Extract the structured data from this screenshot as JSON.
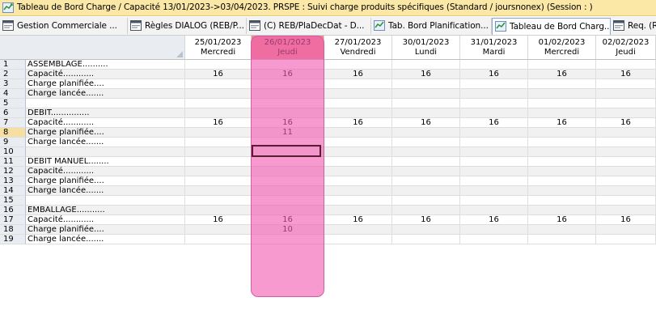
{
  "window": {
    "title": "Tableau de Bord Charge / Capacité 13/01/2023->03/04/2023. PRSPE : Suivi charge produits spécifiques (Standard / joursnonex) (Session : )",
    "icon": "tableau-board-icon"
  },
  "tabs": [
    {
      "label": "Gestion Commerciale ...",
      "icon": "window-icon",
      "active": false
    },
    {
      "label": "Règles DIALOG (REB/P...",
      "icon": "window-icon",
      "active": false
    },
    {
      "label": "(C) REB/PlaDecDat - D...",
      "icon": "window-icon",
      "active": false
    },
    {
      "label": "Tab. Bord Planification...",
      "icon": "tableau-board-icon",
      "active": false
    },
    {
      "label": "Tableau de Bord Charg...",
      "icon": "tableau-board-icon",
      "active": true
    },
    {
      "label": "Req. (R",
      "icon": "window-icon",
      "active": false
    }
  ],
  "columns": [
    {
      "date": "25/01/2023",
      "day": "Mercredi"
    },
    {
      "date": "26/01/2023",
      "day": "Jeudi",
      "highlighted": true
    },
    {
      "date": "27/01/2023",
      "day": "Vendredi"
    },
    {
      "date": "30/01/2023",
      "day": "Lundi"
    },
    {
      "date": "31/01/2023",
      "day": "Mardi"
    },
    {
      "date": "01/02/2023",
      "day": "Mercredi"
    },
    {
      "date": "02/02/2023",
      "day": "Jeudi"
    }
  ],
  "rows": [
    {
      "n": "1",
      "label": "ASSEMBLAGE..........",
      "values": [
        "",
        "",
        "",
        "",
        "",
        "",
        ""
      ]
    },
    {
      "n": "2",
      "label": "Capacité............",
      "values": [
        "16",
        "16",
        "16",
        "16",
        "16",
        "16",
        "16"
      ]
    },
    {
      "n": "3",
      "label": "Charge planifiée....",
      "values": [
        "",
        "",
        "",
        "",
        "",
        "",
        ""
      ]
    },
    {
      "n": "4",
      "label": "Charge lancée.......",
      "values": [
        "",
        "",
        "",
        "",
        "",
        "",
        ""
      ]
    },
    {
      "n": "5",
      "label": "",
      "values": [
        "",
        "",
        "",
        "",
        "",
        "",
        ""
      ]
    },
    {
      "n": "6",
      "label": "DEBIT...............",
      "values": [
        "",
        "",
        "",
        "",
        "",
        "",
        ""
      ]
    },
    {
      "n": "7",
      "label": "Capacité............",
      "values": [
        "16",
        "16",
        "16",
        "16",
        "16",
        "16",
        "16"
      ]
    },
    {
      "n": "8",
      "label": "Charge planifiée....",
      "values": [
        "",
        "11",
        "",
        "",
        "",
        "",
        ""
      ]
    },
    {
      "n": "9",
      "label": "Charge lancée.......",
      "values": [
        "",
        "",
        "",
        "",
        "",
        "",
        ""
      ]
    },
    {
      "n": "10",
      "label": "",
      "values": [
        "",
        "",
        "",
        "",
        "",
        "",
        ""
      ]
    },
    {
      "n": "11",
      "label": "DEBIT MANUEL........",
      "values": [
        "",
        "",
        "",
        "",
        "",
        "",
        ""
      ]
    },
    {
      "n": "12",
      "label": "Capacité............",
      "values": [
        "",
        "",
        "",
        "",
        "",
        "",
        ""
      ]
    },
    {
      "n": "13",
      "label": "Charge planifiée....",
      "values": [
        "",
        "",
        "",
        "",
        "",
        "",
        ""
      ]
    },
    {
      "n": "14",
      "label": "Charge lancée.......",
      "values": [
        "",
        "",
        "",
        "",
        "",
        "",
        ""
      ]
    },
    {
      "n": "15",
      "label": "",
      "values": [
        "",
        "",
        "",
        "",
        "",
        "",
        ""
      ]
    },
    {
      "n": "16",
      "label": "EMBALLAGE...........",
      "values": [
        "",
        "",
        "",
        "",
        "",
        "",
        ""
      ]
    },
    {
      "n": "17",
      "label": "Capacité............",
      "values": [
        "16",
        "16",
        "16",
        "16",
        "16",
        "16",
        "16"
      ]
    },
    {
      "n": "18",
      "label": "Charge planifiée....",
      "values": [
        "",
        "10",
        "",
        "",
        "",
        "",
        ""
      ]
    },
    {
      "n": "19",
      "label": "Charge lancée.......",
      "values": [
        "",
        "",
        "",
        "",
        "",
        "",
        ""
      ]
    }
  ],
  "selection": {
    "row": "8",
    "column": "26/01/2023"
  },
  "colors": {
    "title_bg": "#fbe8a6",
    "highlight": "#f05cb2",
    "highlight_header": "#f08a88",
    "selection_border": "#5a1b33"
  }
}
